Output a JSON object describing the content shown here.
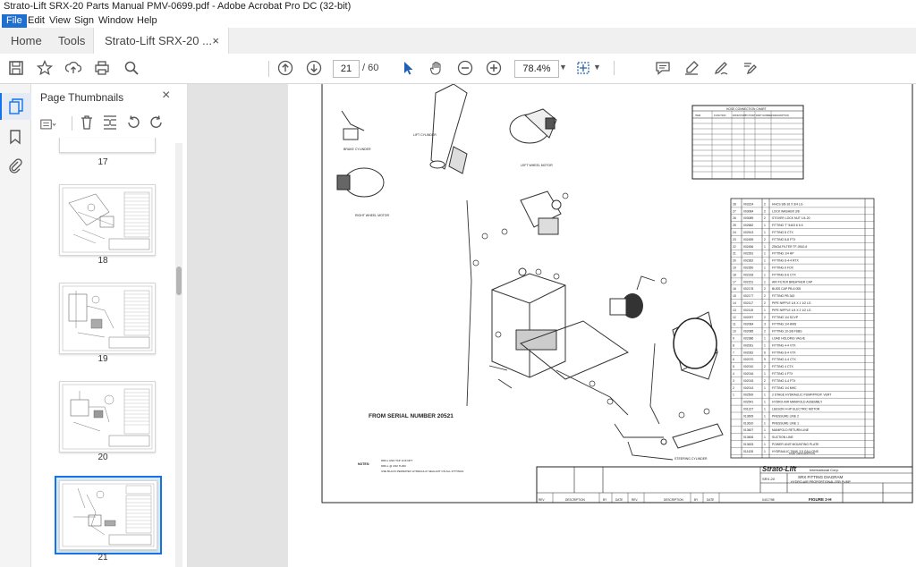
{
  "window": {
    "title": "Strato-Lift SRX-20 Parts Manual PMV-0699.pdf - Adobe Acrobat Pro DC (32-bit)"
  },
  "menu": [
    "File",
    "Edit",
    "View",
    "Sign",
    "Window",
    "Help"
  ],
  "tabs": {
    "home": "Home",
    "tools": "Tools",
    "document": "Strato-Lift SRX-20 ...",
    "close": "×"
  },
  "toolbar": {
    "icons": [
      "save-icon",
      "star-icon",
      "upload-icon",
      "print-icon",
      "search-icon",
      "page-up-icon",
      "page-down-icon",
      "select-arrow-icon",
      "hand-icon",
      "zoom-out-icon",
      "zoom-in-icon",
      "fit-page-icon",
      "comment-icon",
      "highlight-icon",
      "sign-icon",
      "fill-sign-icon"
    ],
    "current_page": "21",
    "total_pages": "/ 60",
    "zoom": "78.4%"
  },
  "panel": {
    "title": "Page Thumbnails",
    "close": "×",
    "thumbnails": [
      {
        "label": "17"
      },
      {
        "label": "18"
      },
      {
        "label": "19"
      },
      {
        "label": "20"
      },
      {
        "label": "21",
        "selected": true
      }
    ]
  },
  "document": {
    "serial_note": "FROM SERIAL NUMBER 20521",
    "hose_table_title": "HOSE CONNECTION CHART",
    "hose_table_headers": [
      "ITEM",
      "FUNCTION",
      "FROM PORT",
      "TO PORT",
      "PART NUMBER",
      "DESCRIPTION"
    ],
    "labels": {
      "brake": "BRAKE CYLINDER",
      "lift": "LIFT CYLINDER",
      "leftwheel": "LEFT WHEEL MOTOR",
      "rightwheel": "RIGHT WHEEL MOTOR",
      "steering": "STEERING CYLINDER"
    },
    "parts": [
      {
        "item": "28",
        "part": "003224",
        "qty": "2",
        "desc": "HHCS 3/8-16 X 3/4 LG"
      },
      {
        "item": "27",
        "part": "003084",
        "qty": "2",
        "desc": "LOCK WASHER 3/8"
      },
      {
        "item": "26",
        "part": "003089",
        "qty": "2",
        "desc": "STOVER LOCK NUT 1/4-20"
      },
      {
        "item": "25",
        "part": "002682",
        "qty": "1",
        "desc": "FITTING 'T' 5403 6 6 6"
      },
      {
        "item": "24",
        "part": "002513",
        "qty": "1",
        "desc": "FITTING 8 CTX"
      },
      {
        "item": "23",
        "part": "002459",
        "qty": "2",
        "desc": "FITTING 8-8 FTX"
      },
      {
        "item": "22",
        "part": "002456",
        "qty": "1",
        "desc": "ZINGA FILTER TF-0510-6"
      },
      {
        "item": "21",
        "part": "002391",
        "qty": "1",
        "desc": "FITTING 1/4 HP"
      },
      {
        "item": "20",
        "part": "002362",
        "qty": "1",
        "desc": "FITTING 6-4-4 RTX"
      },
      {
        "item": "19",
        "part": "002350",
        "qty": "1",
        "desc": "FITTING 6 FOX"
      },
      {
        "item": "18",
        "part": "002318",
        "qty": "1",
        "desc": "FITTING 6-6 CTX"
      },
      {
        "item": "17",
        "part": "002151",
        "qty": "1",
        "desc": "AIR FILTER BREATHER CAP"
      },
      {
        "item": "16",
        "part": "002178",
        "qty": "2",
        "desc": "BUSS CAP PB-6 005"
      },
      {
        "item": "15",
        "part": "002177",
        "qty": "2",
        "desc": "FITTING PB 343"
      },
      {
        "item": "14",
        "part": "002117",
        "qty": "2",
        "desc": "PIPE NIPPLE 1/4 X 1 1/2 LG"
      },
      {
        "item": "13",
        "part": "002115",
        "qty": "1",
        "desc": "PIPE NIPPLE 1/4 X 2 1/2 LG"
      },
      {
        "item": "12",
        "part": "002097",
        "qty": "2",
        "desc": "FITTING 1/4 SCVP"
      },
      {
        "item": "11",
        "part": "002084",
        "qty": "3",
        "desc": "FITTING 1/4 HMS"
      },
      {
        "item": "10",
        "part": "002085",
        "qty": "2",
        "desc": "FITTING 10-3/8 FSBS"
      },
      {
        "item": "9",
        "part": "002386",
        "qty": "1",
        "desc": "LOAD HOLDING VALVE"
      },
      {
        "item": "8",
        "part": "002061",
        "qty": "1",
        "desc": "FITTING 4-4 VTX"
      },
      {
        "item": "7",
        "part": "002062",
        "qty": "6",
        "desc": "FITTING 6-4 VTX"
      },
      {
        "item": "6",
        "part": "002070",
        "qty": "9",
        "desc": "FITTING 4-4 CTX"
      },
      {
        "item": "5",
        "part": "002010",
        "qty": "2",
        "desc": "FITTING 4 CTX"
      },
      {
        "item": "4",
        "part": "002016",
        "qty": "1",
        "desc": "FITTING 4 FTX"
      },
      {
        "item": "3",
        "part": "002015",
        "qty": "2",
        "desc": "FITTING 4-4 FTX"
      },
      {
        "item": "2",
        "part": "002014",
        "qty": "1",
        "desc": "FITTING 1/4 MHC"
      },
      {
        "item": "1",
        "part": "002500",
        "qty": "1",
        "desc": "2 STAGE HYDRAULIC PUMP/PROP. VERT"
      },
      {
        "item": "",
        "part": "002541",
        "qty": "1",
        "desc": "HYDRO-AIR MANIFOLD ASSEMBLY"
      },
      {
        "item": "",
        "part": "001227",
        "qty": "1",
        "desc": "LEESON 4 HP ELECTRIC MOTOR"
      },
      {
        "item": "",
        "part": "013609",
        "qty": "1",
        "desc": "PRESSURE LINE 2"
      },
      {
        "item": "",
        "part": "013610",
        "qty": "1",
        "desc": "PRESSURE LINE 1"
      },
      {
        "item": "",
        "part": "013607",
        "qty": "1",
        "desc": "MANIFOLD RETURN LINE"
      },
      {
        "item": "",
        "part": "013606",
        "qty": "1",
        "desc": "SUCTION LINE"
      },
      {
        "item": "",
        "part": "013633",
        "qty": "1",
        "desc": "POWER UNIT MOUNTING PLATE"
      },
      {
        "item": "",
        "part": "011428",
        "qty": "1",
        "desc": "HYDRAULIC TANK 3.5 GALLONS"
      }
    ],
    "parts_footer": "PART DESCRIPTION",
    "notes": [
      "NOTES:",
      "DRILL AND TAP 1/16 NPT",
      "DRILL @ 3/32 THRU",
      "USE BLACK PERMATEX HYDRAULIC SEALANT ON ALL FITTINGS"
    ],
    "title_block": {
      "company": "Strato-Lift",
      "company_suffix": "International Corp.",
      "part": "SRX-20",
      "title1": "SRX FITTING DIAGRAM",
      "title2": "HYDRO-AIR PROPORTIONAL/JSB PUMP",
      "figure": "FIGURE 2-H",
      "date": "04/17/98"
    },
    "revision_headers": [
      "REV",
      "DESCRIPTION",
      "BY",
      "DATE",
      "REV.",
      "DESCRIPTION",
      "BY",
      "DATE"
    ]
  }
}
